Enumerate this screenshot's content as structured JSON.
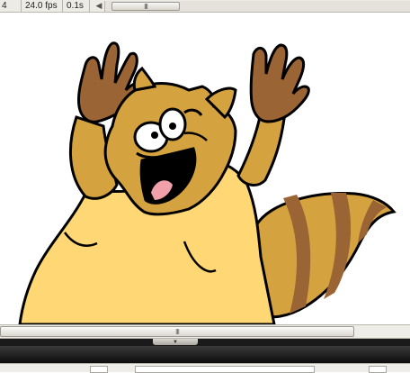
{
  "timeline": {
    "current_frame": "4",
    "fps": "24.0 fps",
    "elapsed": "0.1s",
    "scroll_left_arrow": "◀",
    "scroll_grip": "III"
  },
  "stage": {
    "character": "raccoon",
    "colors": {
      "body_light": "#ffd774",
      "body_mid": "#d4a23e",
      "hand_dark": "#9a6434",
      "tail_stripe": "#9a6434",
      "outline": "#000000",
      "tongue": "#f0a0a8",
      "background": "#ffffff"
    }
  },
  "h_scroll": {
    "grip": "III"
  },
  "splitter": {
    "grip": "▼"
  }
}
